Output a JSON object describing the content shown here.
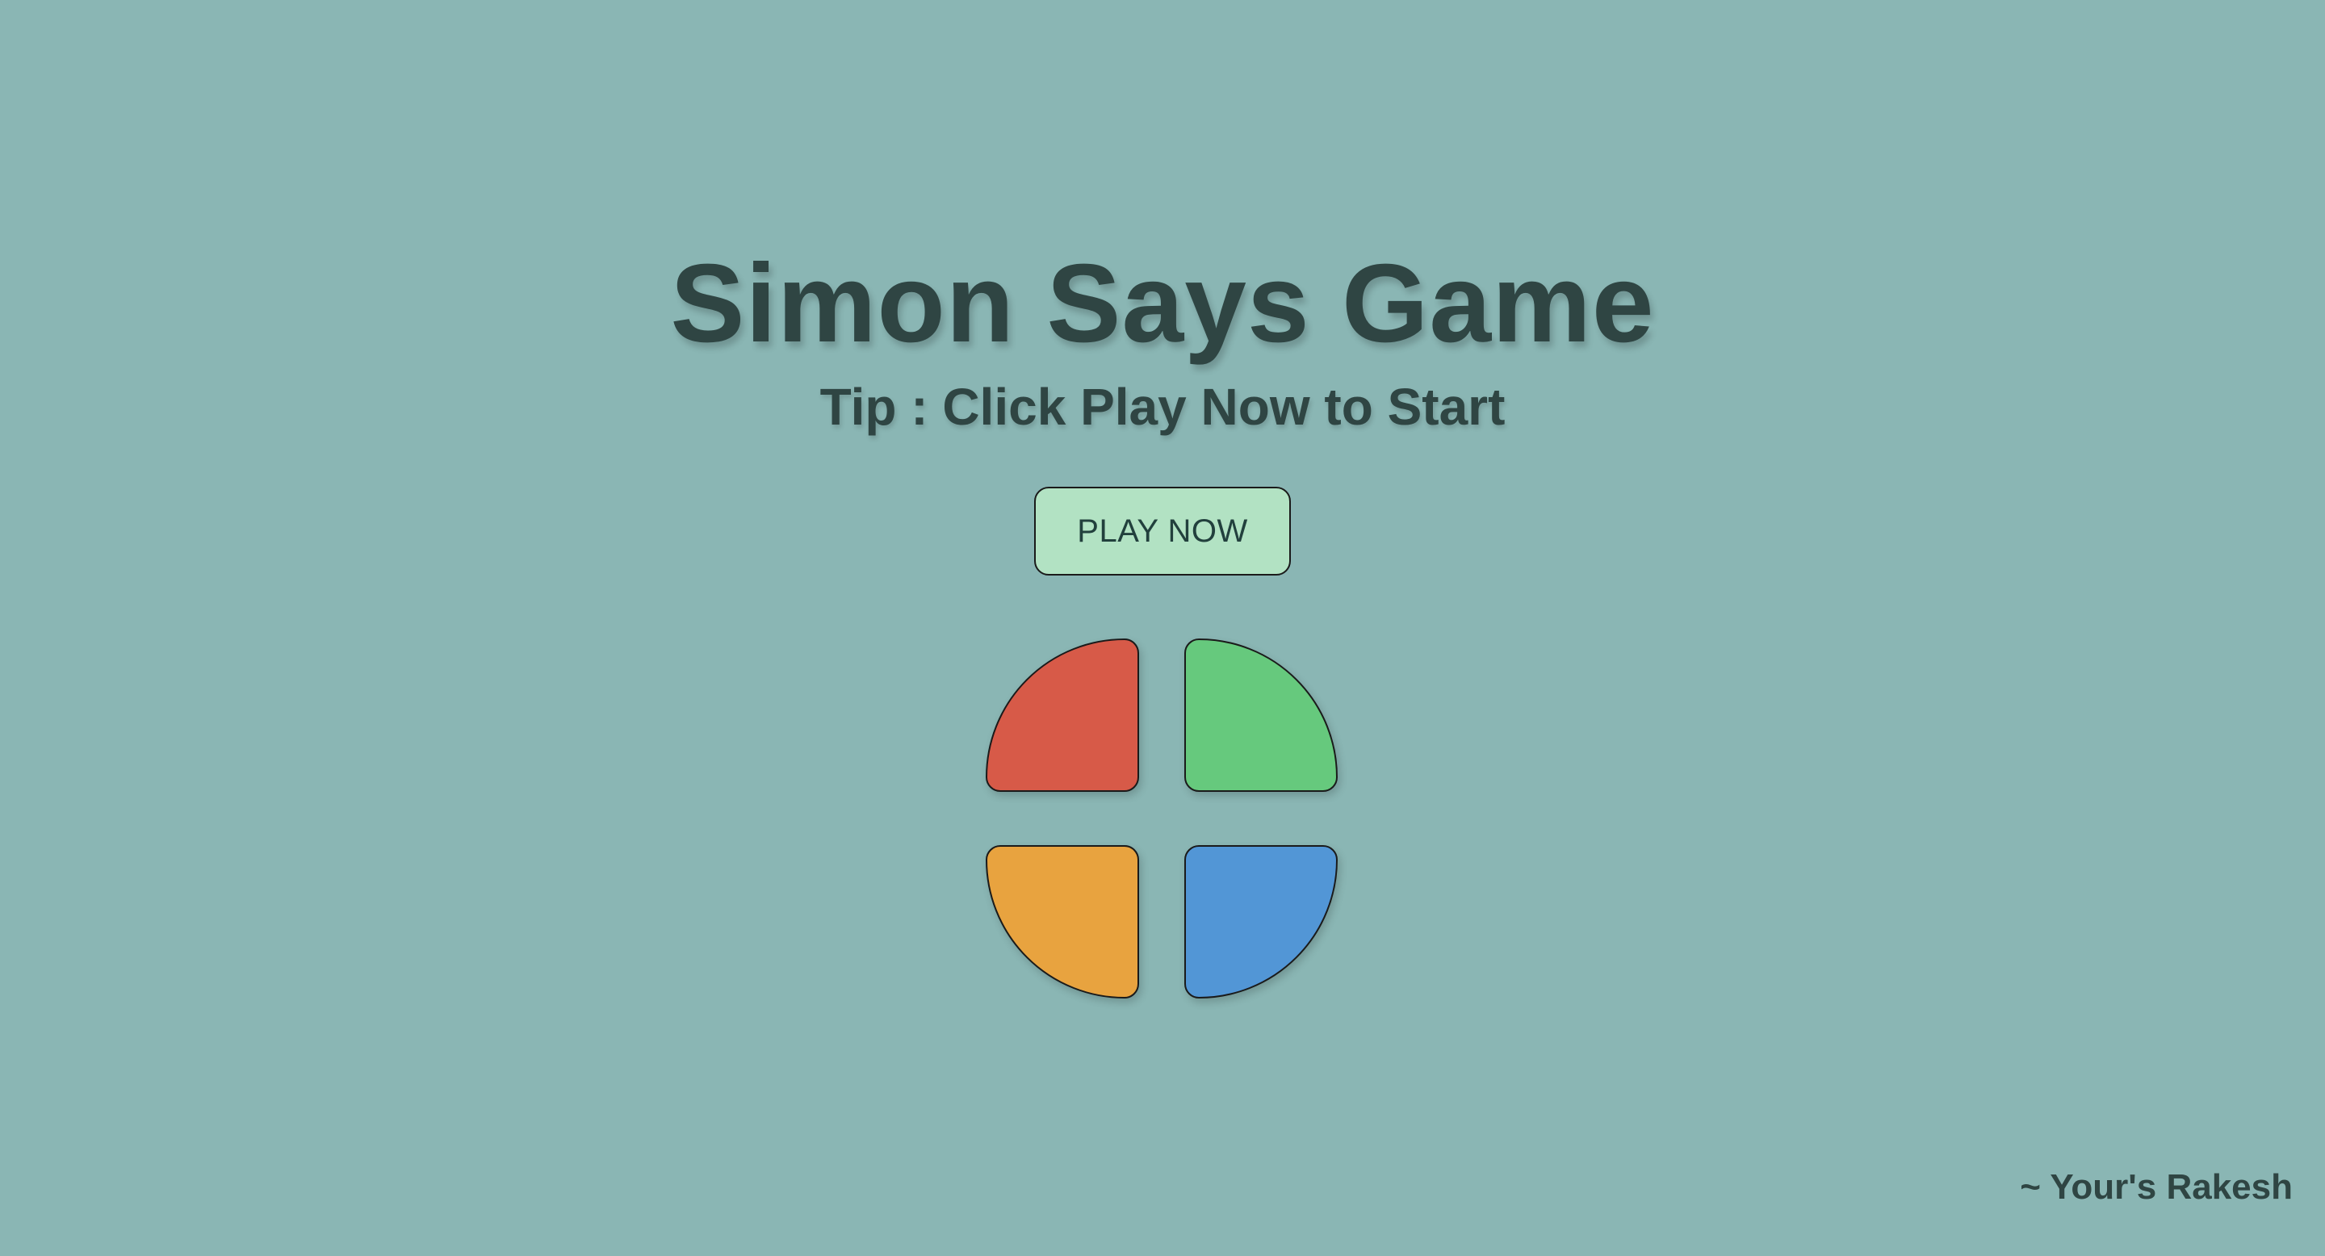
{
  "game": {
    "title": "Simon Says Game",
    "tip": "Tip : Click Play Now to Start",
    "play_button_label": "PLAY NOW",
    "signature": "~ Your's Rakesh"
  },
  "pads": [
    {
      "color_name": "red",
      "color": "#d75a48"
    },
    {
      "color_name": "green",
      "color": "#66c97d"
    },
    {
      "color_name": "yellow",
      "color": "#e8a33f"
    },
    {
      "color_name": "blue",
      "color": "#5296d6"
    }
  ],
  "colors": {
    "background": "#8ab6b4",
    "text": "#2f4543",
    "button_background": "#b2e2c3",
    "button_text": "#22403d"
  }
}
